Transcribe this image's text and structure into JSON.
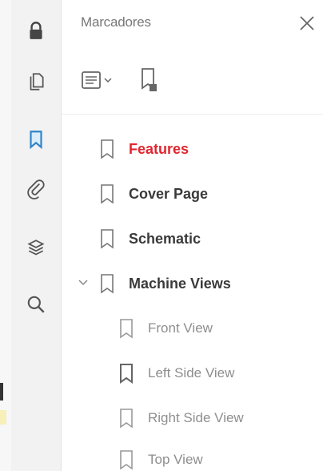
{
  "panel": {
    "title": "Marcadores"
  },
  "toolrail": {
    "items": [
      {
        "icon": "lock-icon"
      },
      {
        "icon": "pages-icon"
      },
      {
        "icon": "bookmark-icon",
        "active": true
      },
      {
        "icon": "attachment-icon"
      },
      {
        "icon": "layers-icon"
      },
      {
        "icon": "search-icon"
      }
    ]
  },
  "toolbar": {
    "options_icon": "options-menu-icon",
    "new_bookmark_icon": "new-bookmark-icon"
  },
  "bookmarks": [
    {
      "label": "Features",
      "level": 0,
      "active": true
    },
    {
      "label": "Cover Page",
      "level": 0
    },
    {
      "label": "Schematic",
      "level": 0
    },
    {
      "label": "Machine Views",
      "level": 0,
      "expanded": true
    },
    {
      "label": "Front View",
      "level": 1
    },
    {
      "label": "Left Side View",
      "level": 1
    },
    {
      "label": "Right Side View",
      "level": 1
    },
    {
      "label": "Top View",
      "level": 1
    }
  ],
  "colors": {
    "accent": "#2f84c8",
    "active_text": "#e0262f"
  }
}
